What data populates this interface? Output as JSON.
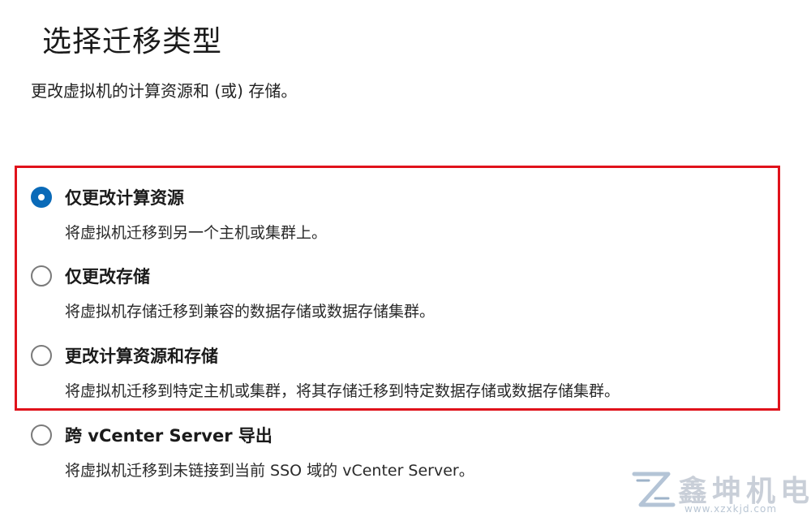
{
  "title": "选择迁移类型",
  "subtitle": "更改虚拟机的计算资源和 (或) 存储。",
  "options": [
    {
      "label": "仅更改计算资源",
      "description": "将虚拟机迁移到另一个主机或集群上。",
      "selected": true
    },
    {
      "label": "仅更改存储",
      "description": "将虚拟机存储迁移到兼容的数据存储或数据存储集群。",
      "selected": false
    },
    {
      "label": "更改计算资源和存储",
      "description": "将虚拟机迁移到特定主机或集群，将其存储迁移到特定数据存储或数据存储集群。",
      "selected": false
    },
    {
      "label": "跨 vCenter Server 导出",
      "description": "将虚拟机迁移到未链接到当前 SSO 域的 vCenter Server。",
      "selected": false
    }
  ],
  "colors": {
    "accent": "#0a6ab8",
    "highlight_border": "#e0121b"
  },
  "watermark": {
    "logo_icon": "xzxkjd-logo-icon",
    "text": "鑫坤机电",
    "url": "www.xzxkjd.com"
  }
}
